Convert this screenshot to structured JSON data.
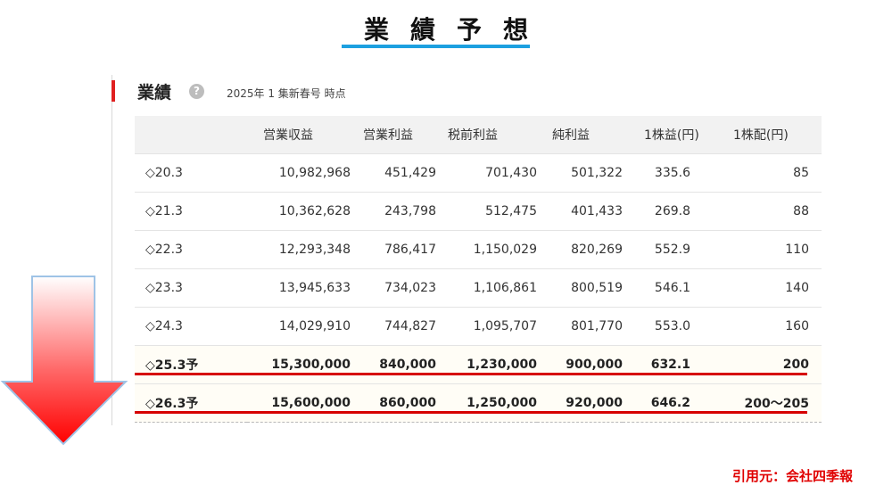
{
  "title": "業績予想",
  "section": {
    "heading": "業績",
    "help_icon_glyph": "?",
    "note": "2025年 1 集新春号 時点"
  },
  "table": {
    "headers": [
      "",
      "営業収益",
      "営業利益",
      "税前利益",
      "純利益",
      "1株益(円)",
      "1株配(円)"
    ],
    "rows": [
      {
        "period": "◇20.3",
        "cells": [
          "10,982,968",
          "451,429",
          "701,430",
          "501,322",
          "335.6",
          "85"
        ]
      },
      {
        "period": "◇21.3",
        "cells": [
          "10,362,628",
          "243,798",
          "512,475",
          "401,433",
          "269.8",
          "88"
        ]
      },
      {
        "period": "◇22.3",
        "cells": [
          "12,293,348",
          "786,417",
          "1,150,029",
          "820,269",
          "552.9",
          "110"
        ]
      },
      {
        "period": "◇23.3",
        "cells": [
          "13,945,633",
          "734,023",
          "1,106,861",
          "800,519",
          "546.1",
          "140"
        ]
      },
      {
        "period": "◇24.3",
        "cells": [
          "14,029,910",
          "744,827",
          "1,095,707",
          "801,770",
          "553.0",
          "160"
        ]
      },
      {
        "period": "◇25.3予",
        "cells": [
          "15,300,000",
          "840,000",
          "1,230,000",
          "900,000",
          "632.1",
          "200"
        ]
      },
      {
        "period": "◇26.3予",
        "cells": [
          "15,600,000",
          "860,000",
          "1,250,000",
          "920,000",
          "646.2",
          "200〜205"
        ]
      }
    ]
  },
  "source": "引用元：会社四季報",
  "colors": {
    "accent_red": "#e02020",
    "title_underline": "#1ca0e0",
    "highlight_line": "#d60000"
  }
}
